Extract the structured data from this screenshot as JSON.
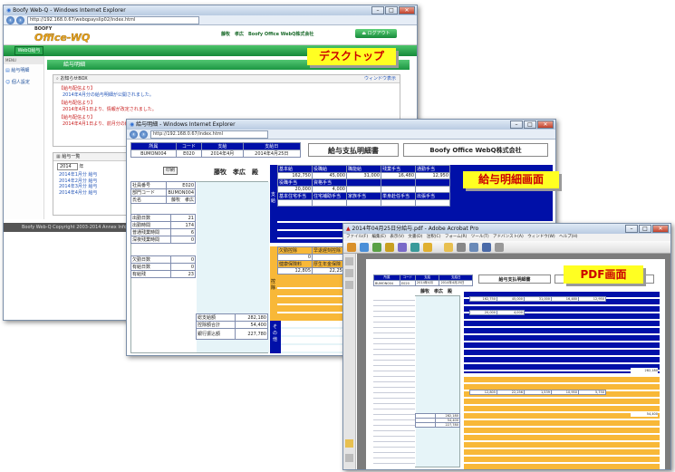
{
  "desktop_window": {
    "title": "Boofy Web-Q - Windows Internet Explorer",
    "address": "http://192.168.0.67/webqpayslip02/index.html",
    "logo_top": "BOOFY",
    "logo_main": "Office-WQ",
    "user_info": "藤牧　孝広　Boofy Office WebQ株式会社",
    "logout_label": "ログアウト",
    "tab_label": "WebQ給与",
    "menu_label": "MENU",
    "menu_items": [
      "給与明細",
      "個人設定"
    ],
    "section_title": "給与明細",
    "notice_title": "お知らせBOX",
    "window_display_link": "ウィンドウ表示",
    "notices": [
      {
        "head": "【給与配信より】",
        "body": "2014年4月分の給与明細が公開されました。"
      },
      {
        "head": "【給与配信より】",
        "body": "2014年4月1日より、情報が改定されました。"
      },
      {
        "head": "【給与配信より】",
        "body": "2014年4月1日より、前月分の給与は公開されました。"
      }
    ],
    "list_title": "給与一覧",
    "year_value": "2014",
    "year_suffix": "年",
    "month_links": [
      "2014年1月分 給与",
      "2014年2月分 給与",
      "2014年3月分 給与",
      "2014年4月分 給与"
    ],
    "copyright": "Boofy Web-Q Copyright 2003-2014 Annex Information"
  },
  "detail_window": {
    "title": "給与明細 - Windows Internet Explorer",
    "address": "http://192.168.0.67/index.html",
    "header_labels": [
      "所属",
      "コード",
      "支給",
      "支給日"
    ],
    "header_values": [
      "BUMON004",
      "E020",
      "2014年4月",
      "2014年4月25日"
    ],
    "doc_title": "給与支払明細書",
    "company": "Boofy Office WebQ株式会社",
    "print_button": "印刷",
    "employee_name": "藤牧　孝広　殿",
    "info_rows": [
      {
        "label": "社員番号",
        "value": "E020"
      },
      {
        "label": "部門コード",
        "value": "BUMON004"
      },
      {
        "label": "氏名",
        "value": "藤牧　孝広"
      }
    ],
    "attendance_rows": [
      {
        "label": "出勤日数",
        "value": "21"
      },
      {
        "label": "出勤時間",
        "value": "174"
      },
      {
        "label": "普通残業時間",
        "value": "6"
      },
      {
        "label": "深夜残業時間",
        "value": "0"
      }
    ],
    "leave_rows": [
      {
        "label": "欠勤日数",
        "value": "0"
      },
      {
        "label": "有給日数",
        "value": "0"
      },
      {
        "label": "有給残",
        "value": "23"
      }
    ],
    "pay_headers_1": [
      "基本給",
      "役職給",
      "職能給",
      "残業手当",
      "通勤手当"
    ],
    "pay_values_1": [
      "162,750",
      "45,000",
      "31,000",
      "16,480",
      "12,950"
    ],
    "pay_headers_2": [
      "役職手当",
      "資格手当"
    ],
    "pay_values_2": [
      "20,000",
      "4,000"
    ],
    "pay_headers_3": [
      "基本住宅手当",
      "住宅補助手当",
      "家族手当",
      "単身赴任手当",
      "出張手当"
    ],
    "section_shikyu": "支給",
    "deduct_headers_1": [
      "欠勤控除",
      "早退遅刻控除"
    ],
    "deduct_values_1": [
      "0",
      "0"
    ],
    "deduct_headers_2": [
      "健康保険料",
      "厚生年金保険"
    ],
    "deduct_values_2": [
      "12,805",
      "22,256"
    ],
    "section_kojo": "控除",
    "section_sonota": "その他",
    "totals": [
      {
        "label": "総支給額",
        "value": "282,180"
      },
      {
        "label": "控除額合計",
        "value": "54,400"
      },
      {
        "label": "銀行振込額",
        "value": "227,780"
      }
    ]
  },
  "pdf_window": {
    "title": "2014年04月25日分給与.pdf - Adobe Acrobat Pro",
    "menu": [
      "ファイル(F)",
      "編集(E)",
      "表示(V)",
      "文書(D)",
      "注釈(C)",
      "フォーム(R)",
      "ツール(T)",
      "アドバンスト(A)",
      "ウィンドウ(W)",
      "ヘルプ(H)"
    ],
    "doc_title": "給与支払明細書",
    "company": "Boofy Office WebQ株式会社",
    "employee_name": "藤牧　孝広　殿",
    "header_labels": [
      "所属",
      "コード",
      "支給",
      "支給日"
    ],
    "header_values": [
      "BUMON004",
      "E020",
      "2014年4月",
      "2014年4月25日"
    ],
    "values_1": [
      "162,750",
      "45,000",
      "31,000",
      "16,480",
      "12,950"
    ],
    "values_2": [
      "20,000",
      "4,000"
    ],
    "value_3": "282,180",
    "deduct_values": [
      "12,805",
      "22,256",
      "1,539",
      "10,950",
      "5,750"
    ],
    "value_4": "54,400",
    "totals": [
      "282,180",
      "54,400",
      "227,780"
    ]
  },
  "labels": {
    "desktop": "デスクトップ",
    "detail": "給与明細画面",
    "pdf": "PDF画面"
  },
  "colors": {
    "blue": "#0010a8",
    "orange": "#f8b838",
    "green": "#168a3a",
    "label_bg": "#ffff22",
    "label_text": "#cc0000"
  }
}
